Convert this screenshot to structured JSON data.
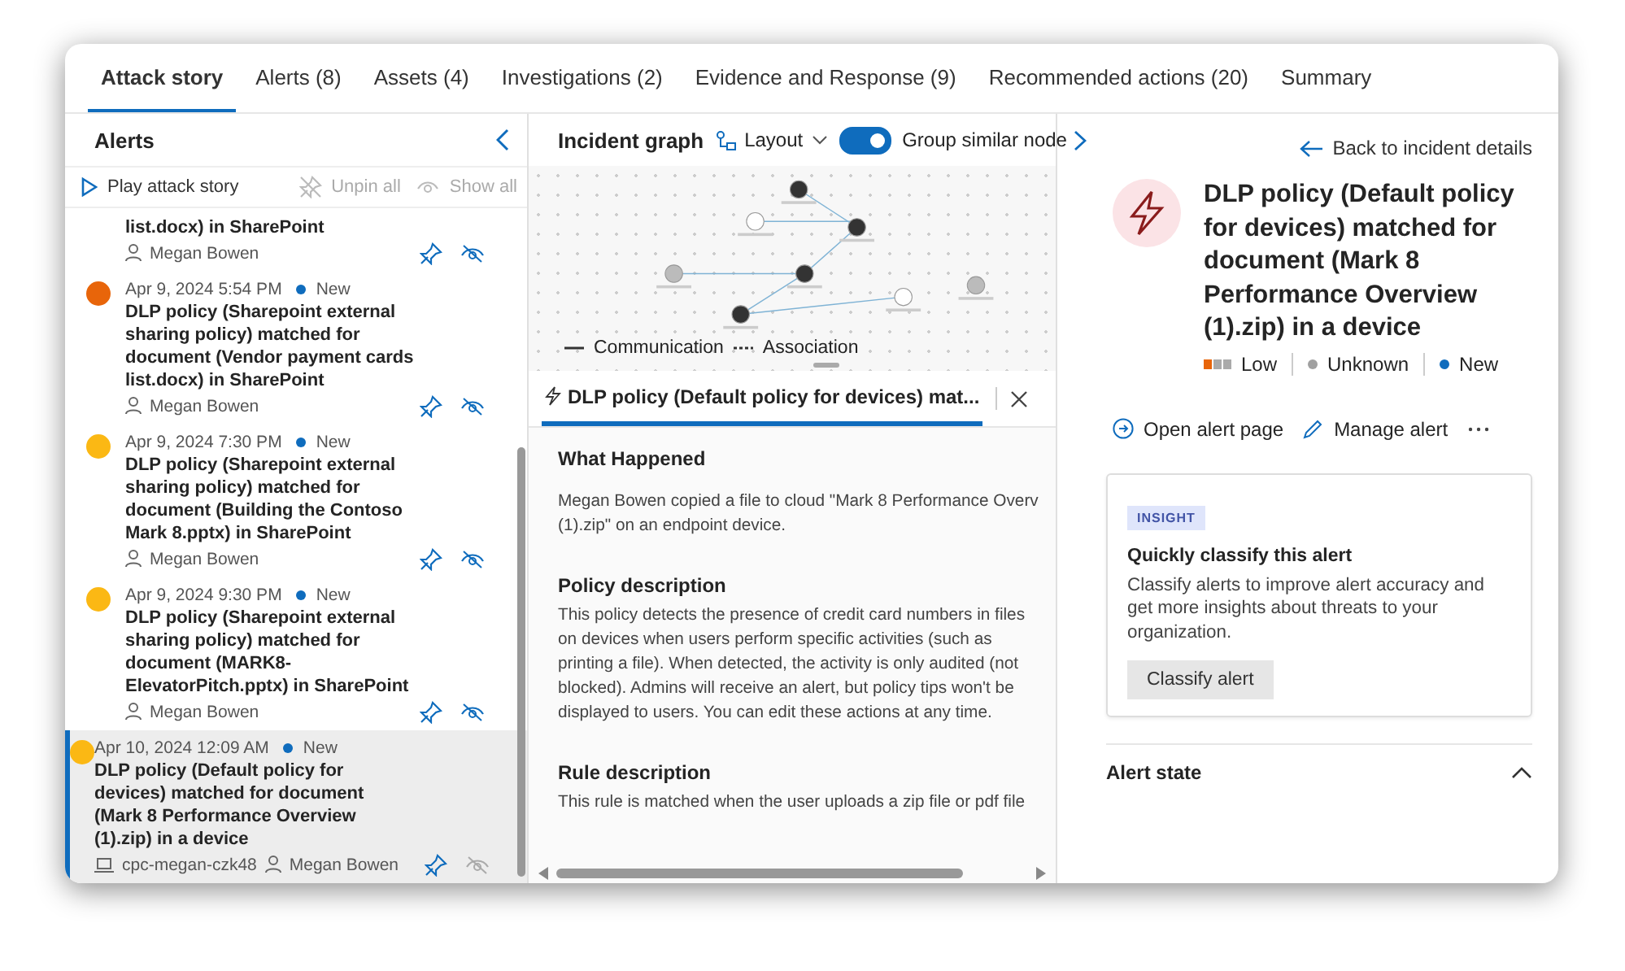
{
  "tabs": [
    {
      "label": "Attack story",
      "selected": true
    },
    {
      "label": "Alerts (8)",
      "selected": false
    },
    {
      "label": "Assets (4)",
      "selected": false
    },
    {
      "label": "Investigations (2)",
      "selected": false
    },
    {
      "label": "Evidence and Response (9)",
      "selected": false
    },
    {
      "label": "Recommended actions (20)",
      "selected": false
    },
    {
      "label": "Summary",
      "selected": false
    }
  ],
  "alerts_panel": {
    "title": "Alerts",
    "toolbar": {
      "play": "Play attack story",
      "unpin": "Unpin all",
      "show": "Show all"
    },
    "items": [
      {
        "kind": "partial",
        "title": "list.docx) in SharePoint",
        "user": "Megan Bowen",
        "selected": false
      },
      {
        "kind": "full",
        "color": "#e8650a",
        "date": "Apr 9, 2024 5:54 PM",
        "status": "New",
        "title": "DLP policy (Sharepoint external sharing policy) matched for document (Vendor payment cards list.docx) in SharePoint",
        "user": "Megan Bowen",
        "selected": false
      },
      {
        "kind": "full",
        "color": "#fbb814",
        "date": "Apr 9, 2024 7:30 PM",
        "status": "New",
        "title": "DLP policy (Sharepoint external sharing policy) matched for document (Building the Contoso Mark 8.pptx) in SharePoint",
        "user": "Megan Bowen",
        "selected": false
      },
      {
        "kind": "full",
        "color": "#fbb814",
        "date": "Apr 9, 2024 9:30 PM",
        "status": "New",
        "title": "DLP policy (Sharepoint external sharing policy) matched for document (MARK8-ElevatorPitch.pptx) in SharePoint",
        "user": "Megan Bowen",
        "selected": false
      },
      {
        "kind": "full",
        "color": "#fbb814",
        "date": "Apr 10, 2024 12:09 AM",
        "status": "New",
        "title": "DLP policy (Default policy for devices) matched for document (Mark 8 Performance Overview (1).zip) in a device",
        "device": "cpc-megan-czk48",
        "user": "Megan Bowen",
        "selected": true
      }
    ]
  },
  "graph_panel": {
    "title": "Incident graph",
    "layout": "Layout",
    "group_toggle": {
      "label": "Group similar node",
      "on": true
    },
    "legend": [
      "Communication",
      "Association"
    ],
    "detail_tab": "DLP policy (Default policy for devices) mat...",
    "sections": [
      {
        "heading": "What Happened",
        "lines": [
          "Megan Bowen copied a file to cloud \"Mark 8 Performance Overv",
          "(1).zip\" on an endpoint device."
        ]
      },
      {
        "heading": "Policy description",
        "lines": [
          "This policy detects the presence of credit card numbers in files",
          "on devices when users perform specific activities (such as",
          "printing a file). When detected, the activity is only audited (not",
          "blocked). Admins will receive an alert, but policy tips won't be",
          "displayed to users. You can edit these actions at any time."
        ]
      },
      {
        "heading": "Rule description",
        "lines": [
          "This rule is matched when the user uploads a zip file or pdf file"
        ]
      }
    ]
  },
  "alert_panel": {
    "back": "Back to incident details",
    "title": "DLP policy (Default policy for devices) matched for document (Mark 8 Performance Overview (1).zip) in a device",
    "severity": {
      "label": "Low",
      "level": 0.33
    },
    "tags": [
      {
        "label": "Unknown",
        "color": "#a0a0a0"
      },
      {
        "label": "New",
        "color": "#0f6cbd"
      }
    ],
    "actions": [
      "Open alert page",
      "Manage alert"
    ],
    "insight": {
      "badge": "INSIGHT",
      "title": "Quickly classify this alert",
      "text": "Classify alerts to improve alert accuracy and get more insights about threats to your organization.",
      "button": "Classify alert"
    },
    "alert_state": {
      "label": "Alert state",
      "expanded": true
    }
  }
}
